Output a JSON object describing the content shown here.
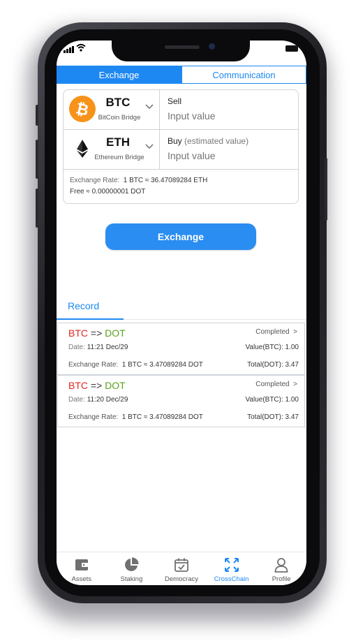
{
  "tabs": [
    {
      "label": "Exchange",
      "active": true
    },
    {
      "label": "Communication",
      "active": false
    }
  ],
  "sell": {
    "coin_symbol": "BTC",
    "coin_network": "BitCoin Bridge",
    "field_label": "Sell",
    "placeholder": "Input value"
  },
  "buy": {
    "coin_symbol": "ETH",
    "coin_network": "Ethereum Bridge",
    "field_label": "Buy",
    "field_hint": "(estimated value)",
    "placeholder": "Input value"
  },
  "rate": {
    "label": "Exchange Rate:",
    "value": "1 BTC ≈ 36.47089284 ETH",
    "fee": "Free ≈ 0.00000001 DOT"
  },
  "exchange_button": "Exchange",
  "record_tab": "Record",
  "records": [
    {
      "from": "BTC",
      "arrow": "=>",
      "to": "DOT",
      "status": "Completed  >",
      "date_label": "Date:",
      "date": "11:21 Dec/29",
      "value": "Value(BTC): 1.00",
      "rate_label": "Exchange Rate:",
      "rate": "1 BTC ≈ 3.47089284 DOT",
      "total": "Total(DOT): 3.47"
    },
    {
      "from": "BTC",
      "arrow": "=>",
      "to": "DOT",
      "status": "Completed  >",
      "date_label": "Date:",
      "date": "11:20 Dec/29",
      "value": "Value(BTC): 1.00",
      "rate_label": "Exchange Rate:",
      "rate": "1 BTC ≈ 3.47089284 DOT",
      "total": "Total(DOT): 3.47"
    }
  ],
  "nav": [
    {
      "label": "Assets",
      "icon": "wallet-icon",
      "active": false
    },
    {
      "label": "Staking",
      "icon": "pie-chart-icon",
      "active": false
    },
    {
      "label": "Democracy",
      "icon": "calendar-check-icon",
      "active": false
    },
    {
      "label": "CrossChain",
      "icon": "expand-arrows-icon",
      "active": true
    },
    {
      "label": "Profile",
      "icon": "user-icon",
      "active": false
    }
  ],
  "colors": {
    "accent": "#1e88f2",
    "button": "#2a8df1",
    "btc_orange": "#f7931a",
    "from_red": "#e0281f",
    "to_green": "#5aa21b"
  }
}
